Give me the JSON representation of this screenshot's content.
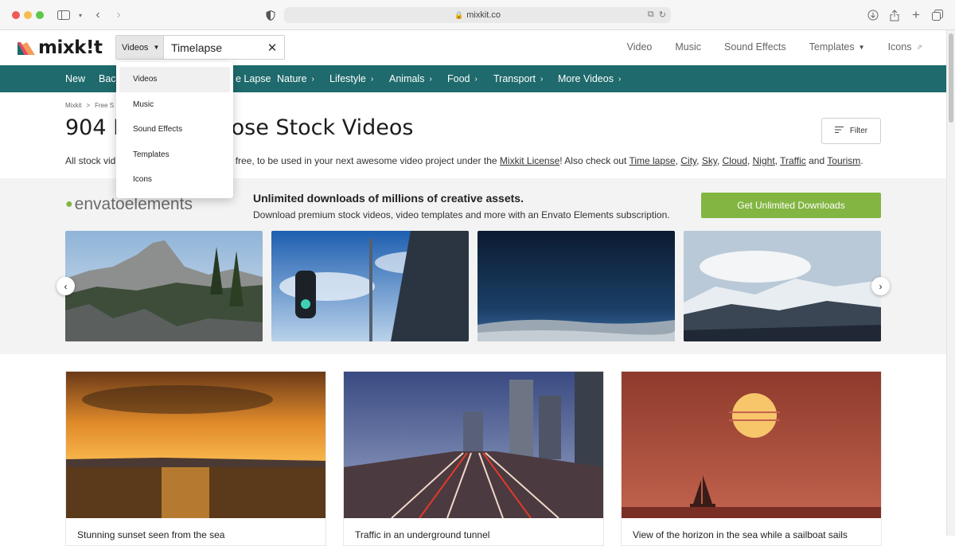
{
  "browser": {
    "url": "mixkit.co",
    "lock_icon": "lock-icon"
  },
  "header": {
    "logo_text": "mixk!t",
    "search": {
      "type_label": "Videos",
      "query": "Timelapse"
    },
    "nav": [
      "Video",
      "Music",
      "Sound Effects",
      "Templates",
      "Icons"
    ]
  },
  "category_bar": {
    "items": [
      "New",
      "Back",
      "e Lapse",
      "Nature",
      "Lifestyle",
      "Animals",
      "Food",
      "Transport",
      "More Videos"
    ]
  },
  "dropdown": {
    "items": [
      "Videos",
      "Music",
      "Sound Effects",
      "Templates",
      "Icons"
    ],
    "selected": "Videos"
  },
  "breadcrumb": {
    "items": [
      "Mixkit",
      ">",
      "Free S"
    ]
  },
  "page": {
    "title_left": "904 F",
    "title_right": "ose Stock Videos",
    "filter_label": "Filter",
    "desc_prefix": "All stock vid",
    "desc_mid": "for free, to be used in your next awesome video project under the",
    "desc_license": "Mixkit License",
    "desc_also": "! Also check out",
    "links": [
      "Time lapse",
      "City",
      "Sky",
      "Cloud",
      "Night",
      "Traffic",
      "Tourism"
    ],
    "and_word": "and"
  },
  "envato": {
    "logo_word_1": "envato",
    "logo_word_2": "elements",
    "headline": "Unlimited downloads of millions of creative assets.",
    "subline": "Download premium stock videos, video templates and more with an Envato Elements subscription.",
    "cta": "Get Unlimited Downloads"
  },
  "cards": [
    {
      "title": "Stunning sunset seen from the sea"
    },
    {
      "title": "Traffic in an underground tunnel"
    },
    {
      "title": "View of the horizon in the sea while a sailboat sails"
    }
  ],
  "colors": {
    "brand_teal": "#1f6a6c",
    "envato_green": "#82b541"
  }
}
